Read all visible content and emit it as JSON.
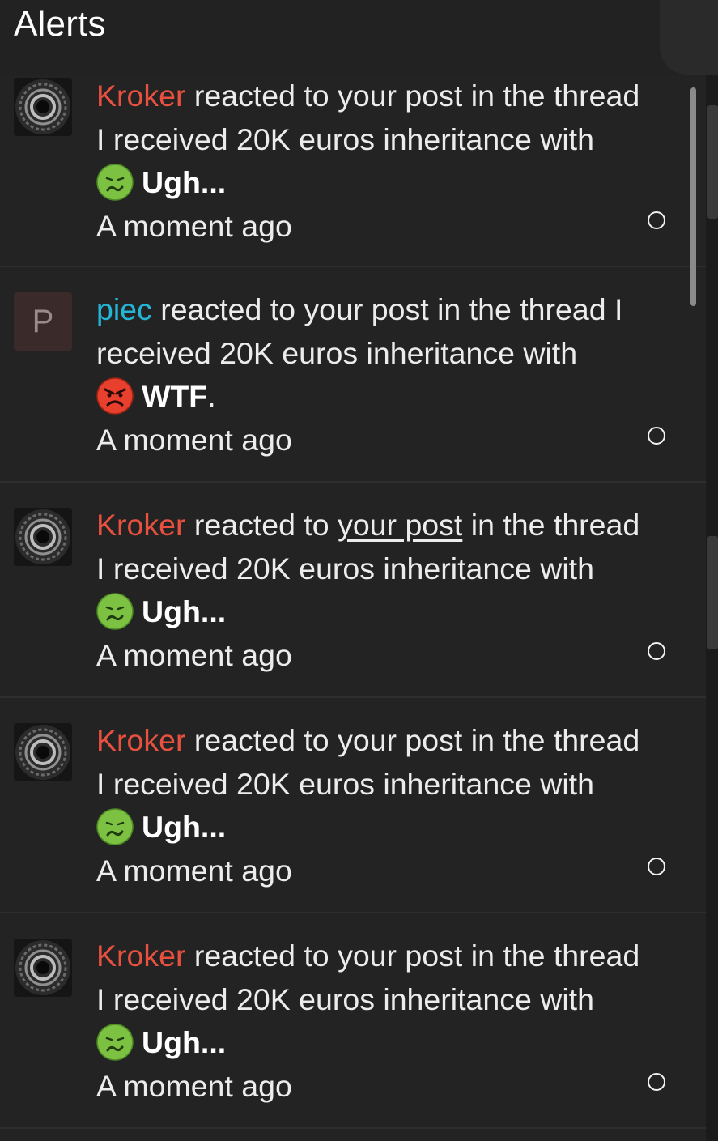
{
  "header": {
    "title": "Alerts"
  },
  "alerts": [
    {
      "user": "Kroker",
      "action": "reacted to your post in the thread",
      "thread": "I received 20K euros inheritance with",
      "reaction": "Ugh...",
      "time": "A moment ago",
      "user_color": "#e8503f",
      "emoji": "nauseated-face"
    },
    {
      "user": "piec",
      "action": "reacted to your post in the thread I",
      "thread": "received 20K euros inheritance with",
      "reaction": "WTF",
      "time": "A moment ago",
      "user_color": "#24b5d6",
      "avatar_letter": "P",
      "emoji": "angry-face"
    },
    {
      "user": "Kroker",
      "action_pre": "reacted to",
      "action_link": "your post",
      "action_post": "in the thread",
      "thread": "I received 20K euros inheritance with",
      "reaction": "Ugh...",
      "time": "A moment ago",
      "user_color": "#e8503f",
      "emoji": "nauseated-face"
    },
    {
      "user": "Kroker",
      "action": "reacted to your post in the thread",
      "thread": "I received 20K euros inheritance with",
      "reaction": "Ugh...",
      "time": "A moment ago",
      "user_color": "#e8503f",
      "emoji": "nauseated-face"
    },
    {
      "user": "Kroker",
      "action": "reacted to your post in the thread",
      "thread": "I received 20K euros inheritance with",
      "reaction": "Ugh...",
      "time": "A moment ago",
      "user_color": "#e8503f",
      "emoji": "nauseated-face"
    }
  ]
}
